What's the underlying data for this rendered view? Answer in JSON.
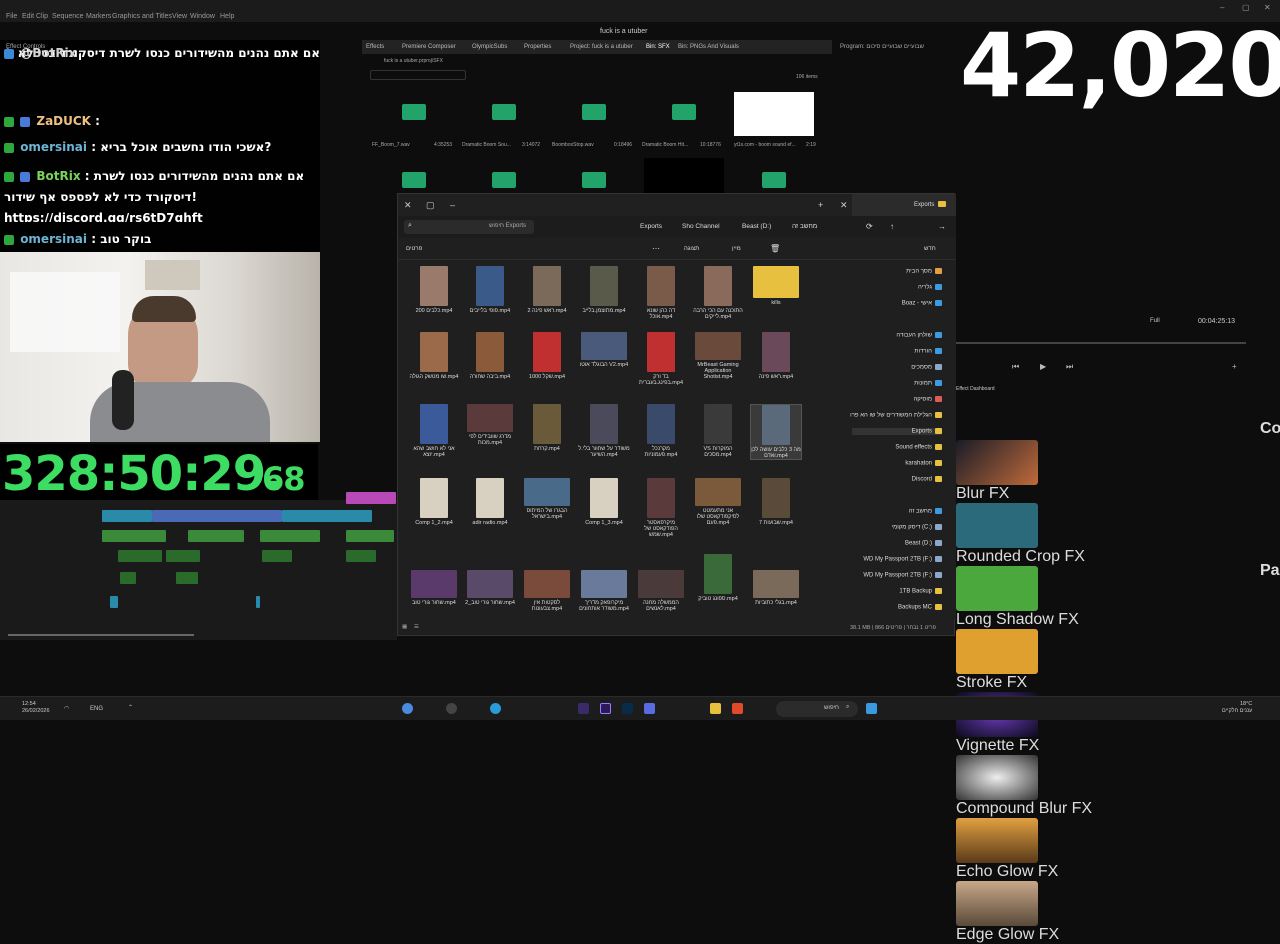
{
  "premiere": {
    "menu": [
      "File",
      "Edit",
      "Clip",
      "Sequence",
      "Markers",
      "Graphics and Titles",
      "View",
      "Window",
      "Help"
    ],
    "project_title": "fuck is a utuber",
    "tabs": [
      "Effects",
      "Premiere Composer",
      "OlympicSubs",
      "Properties",
      "Project: fuck is a utuber",
      "Bin: SFX",
      "Bin: PNGs And Visuals"
    ],
    "bin_path": "fuck is a utuber.prproj\\SFX",
    "item_count": "106 items",
    "bin_items": [
      {
        "name": "FF_Boom_7.wav",
        "dur": "4:35253"
      },
      {
        "name": "Dramatic Boom Sou...",
        "dur": "3:14072"
      },
      {
        "name": "BoomboxStop.wav",
        "dur": "0:18496"
      },
      {
        "name": "Dramatic Boom Hit...",
        "dur": "10:18776"
      },
      {
        "name": "yt1s.com - boom sound ef...",
        "dur": "2:19"
      }
    ],
    "program_label": "Program: שבועיים שבועיים סיכום",
    "timecode": "00:04:25:13",
    "fit": "Full",
    "dashboard": "Effect Dashboard",
    "effect_controls": "Effect Controls",
    "source_label": "Source: (no clips)"
  },
  "chat": [
    {
      "user": "@BotRix",
      "text": "אם אתם נהנים מהשידורים כנסו לשרת דיסקורד כדי לא לפספס אף שידור!https://discord.gg/rs6tD7ghft",
      "color": "#d2d2d2",
      "badge": true
    },
    {
      "user": "ZaDUCK",
      "text": ":",
      "color": "#f0a030",
      "badge": true
    },
    {
      "user": "omersinai",
      "text": ": אשכי הודו נחשבים אוכל בריא?",
      "color": "#6fb3d2",
      "badge": false
    },
    {
      "user": "BotRix",
      "text": ": אם אתם נהנים מהשידורים כנסו לשרת דיסקורד כדי לא לפספס אף שידור! https://discord.gg/rs6tD7ghft",
      "color": "#7cd35c",
      "badge": true
    },
    {
      "user": "omersinai",
      "text": ": בוקר טוב",
      "color": "#6fb3d2",
      "badge": false
    }
  ],
  "stream": {
    "timer": "328:50:29.",
    "timer_small": "68",
    "counter": "42,020",
    "side_letters": [
      "Co",
      "Pa"
    ],
    "channel": "ZaDUCK"
  },
  "explorer": {
    "tab_title": "Exports",
    "breadcrumb": [
      "Beast (D:)",
      "Sho Channel",
      "Exports"
    ],
    "breadcrumb_root": "מחשב זה",
    "search_placeholder": "חיפוש Exports",
    "new_label": "חדש",
    "sort_label": "מיין",
    "view_label": "תצוגה",
    "details_label": "פרטים",
    "status": "38.1 MB  | פריט 1 נבחר  | פריטים 866",
    "nav": [
      {
        "label": "מסך הבית",
        "color": "#e0a040"
      },
      {
        "label": "גלריה",
        "color": "#3b9be0"
      },
      {
        "label": "Boaz - אישי",
        "color": "#3b9be0"
      },
      {
        "label": "שולחן העבודה",
        "color": "#3b9be0"
      },
      {
        "label": "הורדות",
        "color": "#3b9be0"
      },
      {
        "label": "מסמכים",
        "color": "#8aa8c8"
      },
      {
        "label": "תמונות",
        "color": "#3b9be0"
      },
      {
        "label": "מוסיקה",
        "color": "#e05a5a"
      },
      {
        "label": "הגלילת המשודרים של שו הא פרו",
        "color": "#e8c040"
      },
      {
        "label": "Exports",
        "color": "#e8c040"
      },
      {
        "label": "Sound effects",
        "color": "#e8c040"
      },
      {
        "label": "karahaton",
        "color": "#e8c040"
      },
      {
        "label": "Discord",
        "color": "#e8c040"
      },
      {
        "label": "מחשב זה",
        "color": "#3b9be0"
      },
      {
        "label": "דיסק מקומי (C:)",
        "color": "#8aa8c8"
      },
      {
        "label": "Beast (D:)",
        "color": "#8aa8c8"
      },
      {
        "label": "WD My Passport 2TB (F:)",
        "color": "#8aa8c8"
      },
      {
        "label": "WD My Passport 2TB (F:)",
        "color": "#8aa8c8"
      },
      {
        "label": "1TB Backup",
        "color": "#e8c040"
      },
      {
        "label": "Backups MC",
        "color": "#e8c040"
      },
      {
        "label": "CLIPS SHUNI",
        "color": "#e8c040"
      }
    ],
    "files": [
      {
        "name": "kills",
        "kind": "folder"
      },
      {
        "name": "התוכנה עם הכי הרבה לייקים.mp4",
        "kind": "portrait",
        "color": "#8a6a5a"
      },
      {
        "name": "דה כהן שונא אוכל.mp4",
        "kind": "portrait",
        "color": "#7a5a48"
      },
      {
        "name": "מתוצמן.בלייב.mp4",
        "kind": "portrait",
        "color": "#5a5a4a"
      },
      {
        "name": "ראש פינה 2.mp4",
        "kind": "portrait",
        "color": "#7b6a5a"
      },
      {
        "name": "פופי בלייבים.mp4",
        "kind": "portrait",
        "color": "#3a5a8a"
      },
      {
        "name": "200 כלבים.mp4",
        "kind": "portrait",
        "color": "#9a7a6a"
      },
      {
        "name": "ראש פינה.mp4",
        "kind": "portrait",
        "color": "#6a4a5a"
      },
      {
        "name": "MrBeast Gaming Application Shotist.mp4",
        "kind": "portrait",
        "color": "#6a4a3a"
      },
      {
        "name": "בד ורק בפינג.בעברית.mp4",
        "kind": "portrait",
        "color": "#c03030"
      },
      {
        "name": "הבוגלד אוטו V2.mp4",
        "kind": "wide",
        "color": "#4a5a7a"
      },
      {
        "name": "1000 שקל.mp4",
        "kind": "portrait",
        "color": "#c03030"
      },
      {
        "name": "ביבה שחורה.mp4",
        "kind": "portrait",
        "color": "#8a5a3a"
      },
      {
        "name": "שו מטשק הגולה.mp4",
        "kind": "portrait",
        "color": "#9a6a4a"
      },
      {
        "name": "מה 3 כלבים עושה לכן ואדם.mp4",
        "kind": "portrait",
        "color": "#5a6a7a"
      },
      {
        "name": "VS המוקרות מסכים.mp4",
        "kind": "portrait",
        "color": "#3a3a3a"
      },
      {
        "name": "מקרנכל פעמוניות.mp4",
        "kind": "portrait",
        "color": "#3a4a6a"
      },
      {
        "name": "משודר על שחוור בלי.ל השיער.mp4",
        "kind": "portrait",
        "color": "#4a4a5a"
      },
      {
        "name": "קרחת.mp4",
        "kind": "portrait",
        "color": "#6a5a3a"
      },
      {
        "name": "מדרג שוובידים לפי מכות.mp4",
        "kind": "wide",
        "color": "#5a3a3a"
      },
      {
        "name": "אני לא חושב שהא יוצא.mp4",
        "kind": "portrait",
        "color": "#3a5a9a"
      },
      {
        "name": "7 שבועות.mp4",
        "kind": "portrait",
        "color": "#5a4a3a"
      },
      {
        "name": "אני מתעמטט לסיקפודקאסט שלו פעם.mp4",
        "kind": "wide",
        "color": "#7a5a3a"
      },
      {
        "name": "מיקרפאסטר הפודקאסט של שמש.mp4",
        "kind": "portrait",
        "color": "#5a3a3a"
      },
      {
        "name": "Comp 1_3.mp4",
        "kind": "portrait",
        "color": "#d8d0c0"
      },
      {
        "name": "הבגרו של המיתוס בישראל.mp4",
        "kind": "wide",
        "color": "#4a6a8a"
      },
      {
        "name": "adir radio.mp4",
        "kind": "portrait",
        "color": "#d8d0c0"
      },
      {
        "name": "Comp 1_2.mp4",
        "kind": "portrait",
        "color": "#d8d0c0"
      },
      {
        "name": "בגלי כתוביות.mp4",
        "kind": "wide",
        "color": "#7a6a5a"
      },
      {
        "name": "ספונג טוביק.mp4",
        "kind": "portrait",
        "color": "#3a6a3a"
      },
      {
        "name": "הממשלה מחנה לאנשים.mp4",
        "kind": "wide",
        "color": "#4a3a3a"
      },
      {
        "name": "מיקרופאק מדריך משודר אותחונים.mp4",
        "kind": "wide",
        "color": "#6a7a9a"
      },
      {
        "name": "לסקטות אין צבעונות.mp4",
        "kind": "wide",
        "color": "#7a4a3a"
      },
      {
        "name": "שחור גורי טוב_2.mp4",
        "kind": "wide",
        "color": "#5a4a6a"
      },
      {
        "name": "שחור גורי טוב.mp4",
        "kind": "wide",
        "color": "#5a3a6a"
      }
    ]
  },
  "effects": [
    {
      "name": "Blur FX"
    },
    {
      "name": "Rounded Crop FX"
    },
    {
      "name": "Long Shadow FX"
    },
    {
      "name": "Stroke FX"
    },
    {
      "name": "Vignette FX"
    },
    {
      "name": "Compound Blur FX"
    },
    {
      "name": "Echo Glow FX"
    },
    {
      "name": "Edge Glow FX"
    }
  ],
  "taskbar": {
    "time": "12:54",
    "date": "26/02/2026",
    "lang": "ENG",
    "search": "חיפוש",
    "weather_temp": "18°C",
    "weather_desc": "עננים חלקיים"
  }
}
